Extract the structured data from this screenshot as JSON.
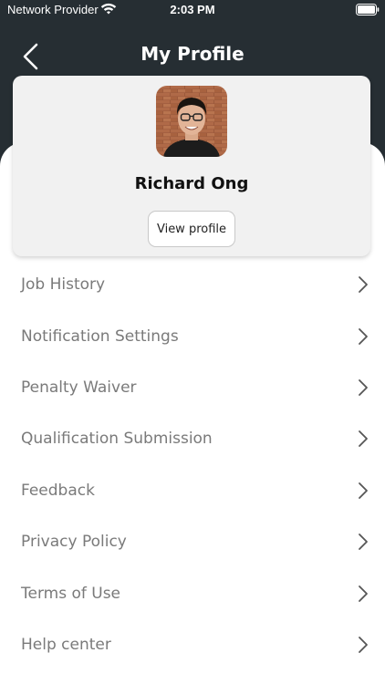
{
  "status_bar": {
    "carrier": "Network Provider",
    "time": "2:03 PM",
    "wifi_icon": "wifi-icon",
    "battery_icon": "battery-icon"
  },
  "nav": {
    "title": "My Profile",
    "back_icon": "chevron-left-icon"
  },
  "profile": {
    "name": "Richard Ong",
    "view_profile_label": "View profile",
    "avatar": "avatar-photo"
  },
  "menu": {
    "items": [
      {
        "label": "Job History"
      },
      {
        "label": "Notification Settings"
      },
      {
        "label": "Penalty Waiver"
      },
      {
        "label": "Qualification Submission"
      },
      {
        "label": "Feedback"
      },
      {
        "label": "Privacy Policy"
      },
      {
        "label": "Terms of Use"
      },
      {
        "label": "Help center"
      }
    ],
    "chevron_icon": "chevron-right-icon"
  },
  "colors": {
    "header_bg": "#262e33",
    "card_bg": "#f1f1f1",
    "menu_text": "#7a7a7a"
  }
}
